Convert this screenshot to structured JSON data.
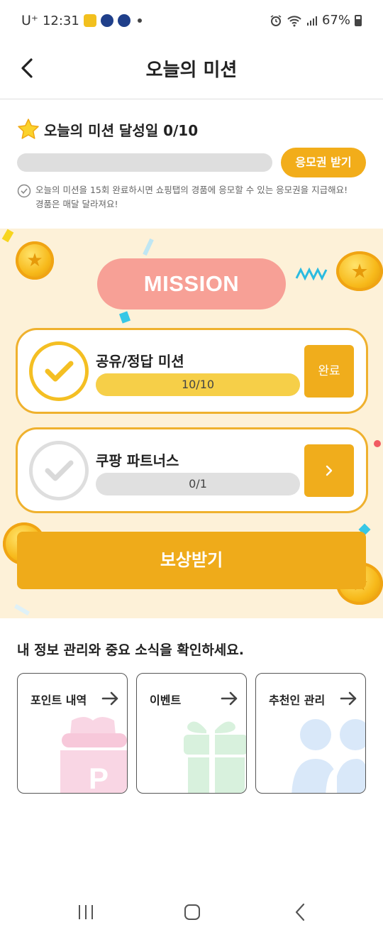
{
  "status_bar": {
    "carrier": "U⁺",
    "time": "12:31",
    "battery": "67%"
  },
  "header": {
    "title": "오늘의 미션"
  },
  "summary": {
    "title": "오늘의 미션 달성일 0/10",
    "progress_fraction": 0,
    "ticket_button": "응모권 받기",
    "notice_line1": "오늘의 미션을 15회 완료하시면 쇼핑탭의 경품에 응모할 수 있는 응모권을 지급해요!",
    "notice_line2": "경품은 매달 달라져요!"
  },
  "mission": {
    "badge": "MISSION",
    "cards": [
      {
        "title": "공유/정답 미션",
        "progress_label": "10/10",
        "progress_fraction": 1.0,
        "completed": true,
        "button_label": "완료"
      },
      {
        "title": "쿠팡 파트너스",
        "progress_label": "0/1",
        "progress_fraction": 0,
        "completed": false,
        "button_icon": "chevron-right-icon"
      }
    ],
    "reward_button": "보상받기"
  },
  "info": {
    "heading": "내 정보 관리와 중요 소식을 확인하세요.",
    "cards": [
      {
        "label": "포인트 내역",
        "icon": "point-pouch-icon",
        "color": "#f9d6e4"
      },
      {
        "label": "이벤트",
        "icon": "gift-icon",
        "color": "#d8f1dd"
      },
      {
        "label": "추천인 관리",
        "icon": "people-icon",
        "color": "#d9e8f9"
      }
    ]
  },
  "colors": {
    "accent": "#efab1a",
    "mission_bg": "#fdf1d8",
    "badge": "#f7a096"
  }
}
